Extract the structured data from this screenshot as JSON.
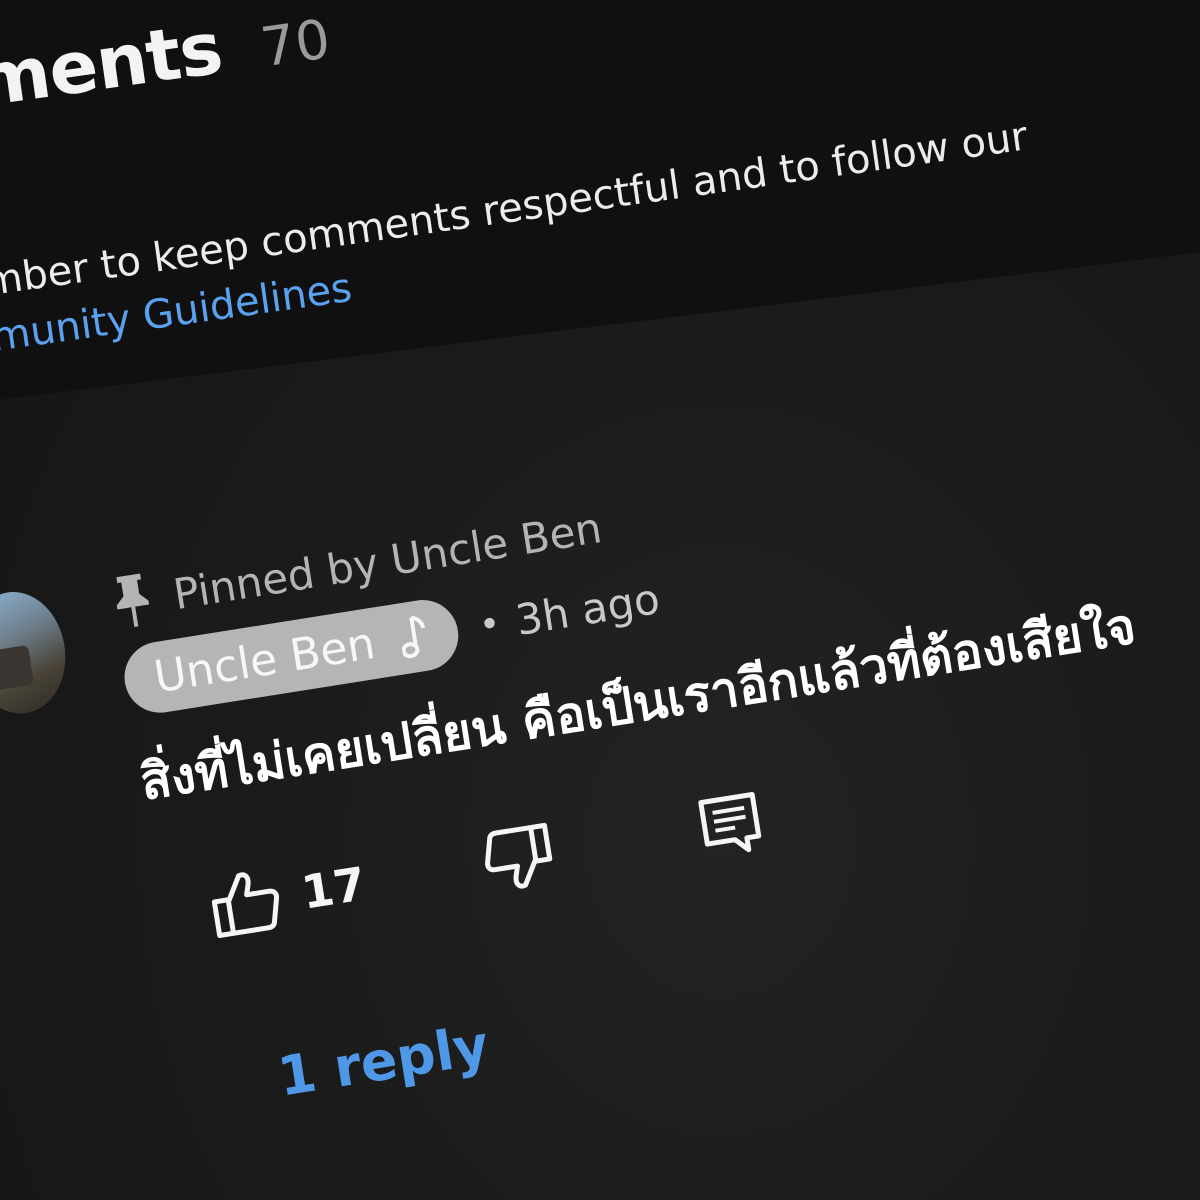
{
  "header": {
    "title": "ments",
    "count": "70"
  },
  "notice": {
    "line1": "mber to keep comments respectful and to follow our",
    "link": "munity Guidelines"
  },
  "comment": {
    "pinned_label": "Pinned by Uncle Ben",
    "author": "Uncle Ben",
    "separator": "•",
    "time": "3h ago",
    "text": "สิ่งที่ไม่เคยเปลี่ยน คือเป็นเราอีกแล้วที่ต้องเสียใจ",
    "like_count": "17",
    "replies_label": "1 reply"
  },
  "icons": {
    "pin": "pin-icon",
    "note": "music-note-icon",
    "like": "thumb-up-icon",
    "dislike": "thumb-down-icon",
    "reply": "reply-comment-icon"
  },
  "colors": {
    "background": "#1a1a1b",
    "link": "#5aa2f0",
    "chip": "#b5b5b5"
  }
}
